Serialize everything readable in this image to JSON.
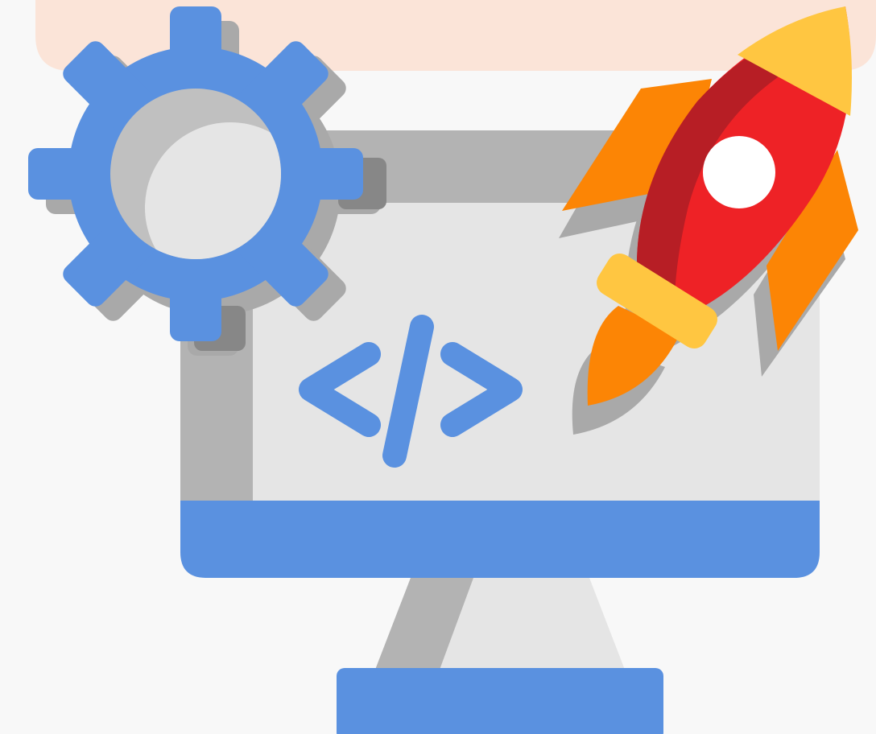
{
  "illustration": {
    "subject": "web-development-launch",
    "icons": [
      "gear-icon",
      "monitor-icon",
      "code-brackets-icon",
      "rocket-icon"
    ]
  },
  "colors": {
    "background": "#f8f8f8",
    "top_banner": "#fbe4d8",
    "blue": "#5a91e0",
    "monitor_frame": "#b3b3b3",
    "monitor_screen": "#e5e5e5",
    "shadow": "#a9a9a9",
    "shadow_dark": "#878787",
    "rocket_red": "#ee2226",
    "rocket_dark_red": "#b71e25",
    "rocket_yellow": "#ffc641",
    "rocket_orange": "#fc8505",
    "window_white": "#ffffff"
  }
}
